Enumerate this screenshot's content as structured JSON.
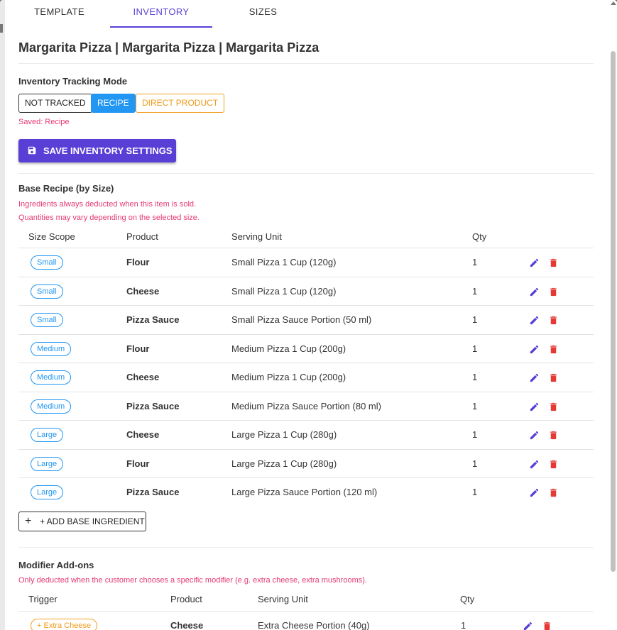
{
  "tabs": [
    {
      "label": "TEMPLATE"
    },
    {
      "label": "INVENTORY"
    },
    {
      "label": "SIZES"
    }
  ],
  "page_title": "Margarita Pizza | Margarita Pizza | Margarita Pizza",
  "tracking": {
    "label": "Inventory Tracking Mode",
    "modes": {
      "not_tracked": "NOT TRACKED",
      "recipe": "RECIPE",
      "direct_product": "DIRECT PRODUCT"
    },
    "selected": "RECIPE",
    "saved_text": "Saved: Recipe",
    "save_button": "SAVE INVENTORY SETTINGS"
  },
  "base_recipe": {
    "title": "Base Recipe (by Size)",
    "note1": "Ingredients always deducted when this item is sold.",
    "note2": "Quantities may vary depending on the selected size.",
    "headers": {
      "size_scope": "Size Scope",
      "product": "Product",
      "serving_unit": "Serving Unit",
      "qty": "Qty"
    },
    "rows": [
      {
        "size": "Small",
        "product": "Flour",
        "unit": "Small Pizza 1 Cup (120g)",
        "qty": "1"
      },
      {
        "size": "Small",
        "product": "Cheese",
        "unit": "Small Pizza 1 Cup (120g)",
        "qty": "1"
      },
      {
        "size": "Small",
        "product": "Pizza Sauce",
        "unit": "Small Pizza Sauce Portion (50 ml)",
        "qty": "1"
      },
      {
        "size": "Medium",
        "product": "Flour",
        "unit": "Medium Pizza 1 Cup (200g)",
        "qty": "1"
      },
      {
        "size": "Medium",
        "product": "Cheese",
        "unit": "Medium Pizza 1 Cup (200g)",
        "qty": "1"
      },
      {
        "size": "Medium",
        "product": "Pizza Sauce",
        "unit": "Medium Pizza Sauce Portion (80 ml)",
        "qty": "1"
      },
      {
        "size": "Large",
        "product": "Cheese",
        "unit": "Large Pizza 1 Cup (280g)",
        "qty": "1"
      },
      {
        "size": "Large",
        "product": "Flour",
        "unit": "Large Pizza 1 Cup (280g)",
        "qty": "1"
      },
      {
        "size": "Large",
        "product": "Pizza Sauce",
        "unit": "Large Pizza Sauce Portion (120 ml)",
        "qty": "1"
      }
    ],
    "add_button": "+ ADD BASE INGREDIENT"
  },
  "modifier_addons": {
    "title": "Modifier Add-ons",
    "note": "Only deducted when the customer chooses a specific modifier (e.g. extra cheese, extra mushrooms).",
    "headers": {
      "trigger": "Trigger",
      "product": "Product",
      "serving_unit": "Serving Unit",
      "qty": "Qty"
    },
    "rows": [
      {
        "trigger": "+ Extra Cheese",
        "product": "Cheese",
        "unit": "Extra Cheese Portion (40g)",
        "qty": "1"
      }
    ]
  },
  "colors": {
    "accent": "#5a3fd6",
    "recipe_blue": "#2196f3",
    "direct_orange": "#ef9a1a",
    "pink": "#e53973",
    "delete_red": "#e53935"
  },
  "icons": {
    "edit": "pencil-icon",
    "delete": "trash-icon",
    "save": "floppy-disk-icon",
    "add": "plus-icon"
  }
}
